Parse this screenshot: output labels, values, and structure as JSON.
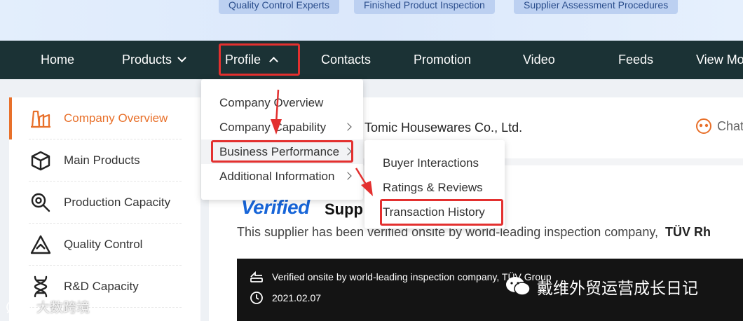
{
  "banner": {
    "chips": [
      "Quality Control Experts",
      "Finished Product Inspection",
      "Supplier Assessment Procedures"
    ]
  },
  "nav": {
    "items": [
      "Home",
      "Products",
      "Profile",
      "Contacts",
      "Promotion",
      "Video",
      "Feeds",
      "View More"
    ]
  },
  "sidebar": {
    "items": [
      {
        "label": "Company Overview",
        "icon": "factory-icon",
        "active": true
      },
      {
        "label": "Main Products",
        "icon": "box-icon"
      },
      {
        "label": "Production Capacity",
        "icon": "magnifier-gear-icon"
      },
      {
        "label": "Quality Control",
        "icon": "triangle-check-icon"
      },
      {
        "label": "R&D Capacity",
        "icon": "dna-icon"
      }
    ]
  },
  "profile_menu": {
    "items": [
      "Company Overview",
      "Company Capability",
      "Business Performance",
      "Additional Information"
    ]
  },
  "business_submenu": {
    "items": [
      "Buyer Interactions",
      "Ratings & Reviews",
      "Transaction History"
    ]
  },
  "main": {
    "company_name": "Tomic Housewares Co., Ltd.",
    "chat_label": "Chat",
    "verified_logo": "Verified",
    "section_title": "Supp",
    "verify_text": "This supplier has been verified onsite by world-leading inspection company,",
    "verify_company": "TÜV Rh",
    "dark_line1": "Verified onsite by world-leading inspection company, TÜV Group",
    "dark_date": "2021.02.07"
  },
  "watermarks": {
    "left": "大数跨境",
    "right": "戴维外贸运营成长日记"
  },
  "colors": {
    "nav_bg": "#1b3235",
    "accent_orange": "#e8702a",
    "highlight_red": "#e3302f",
    "verified_blue": "#1765d8"
  }
}
